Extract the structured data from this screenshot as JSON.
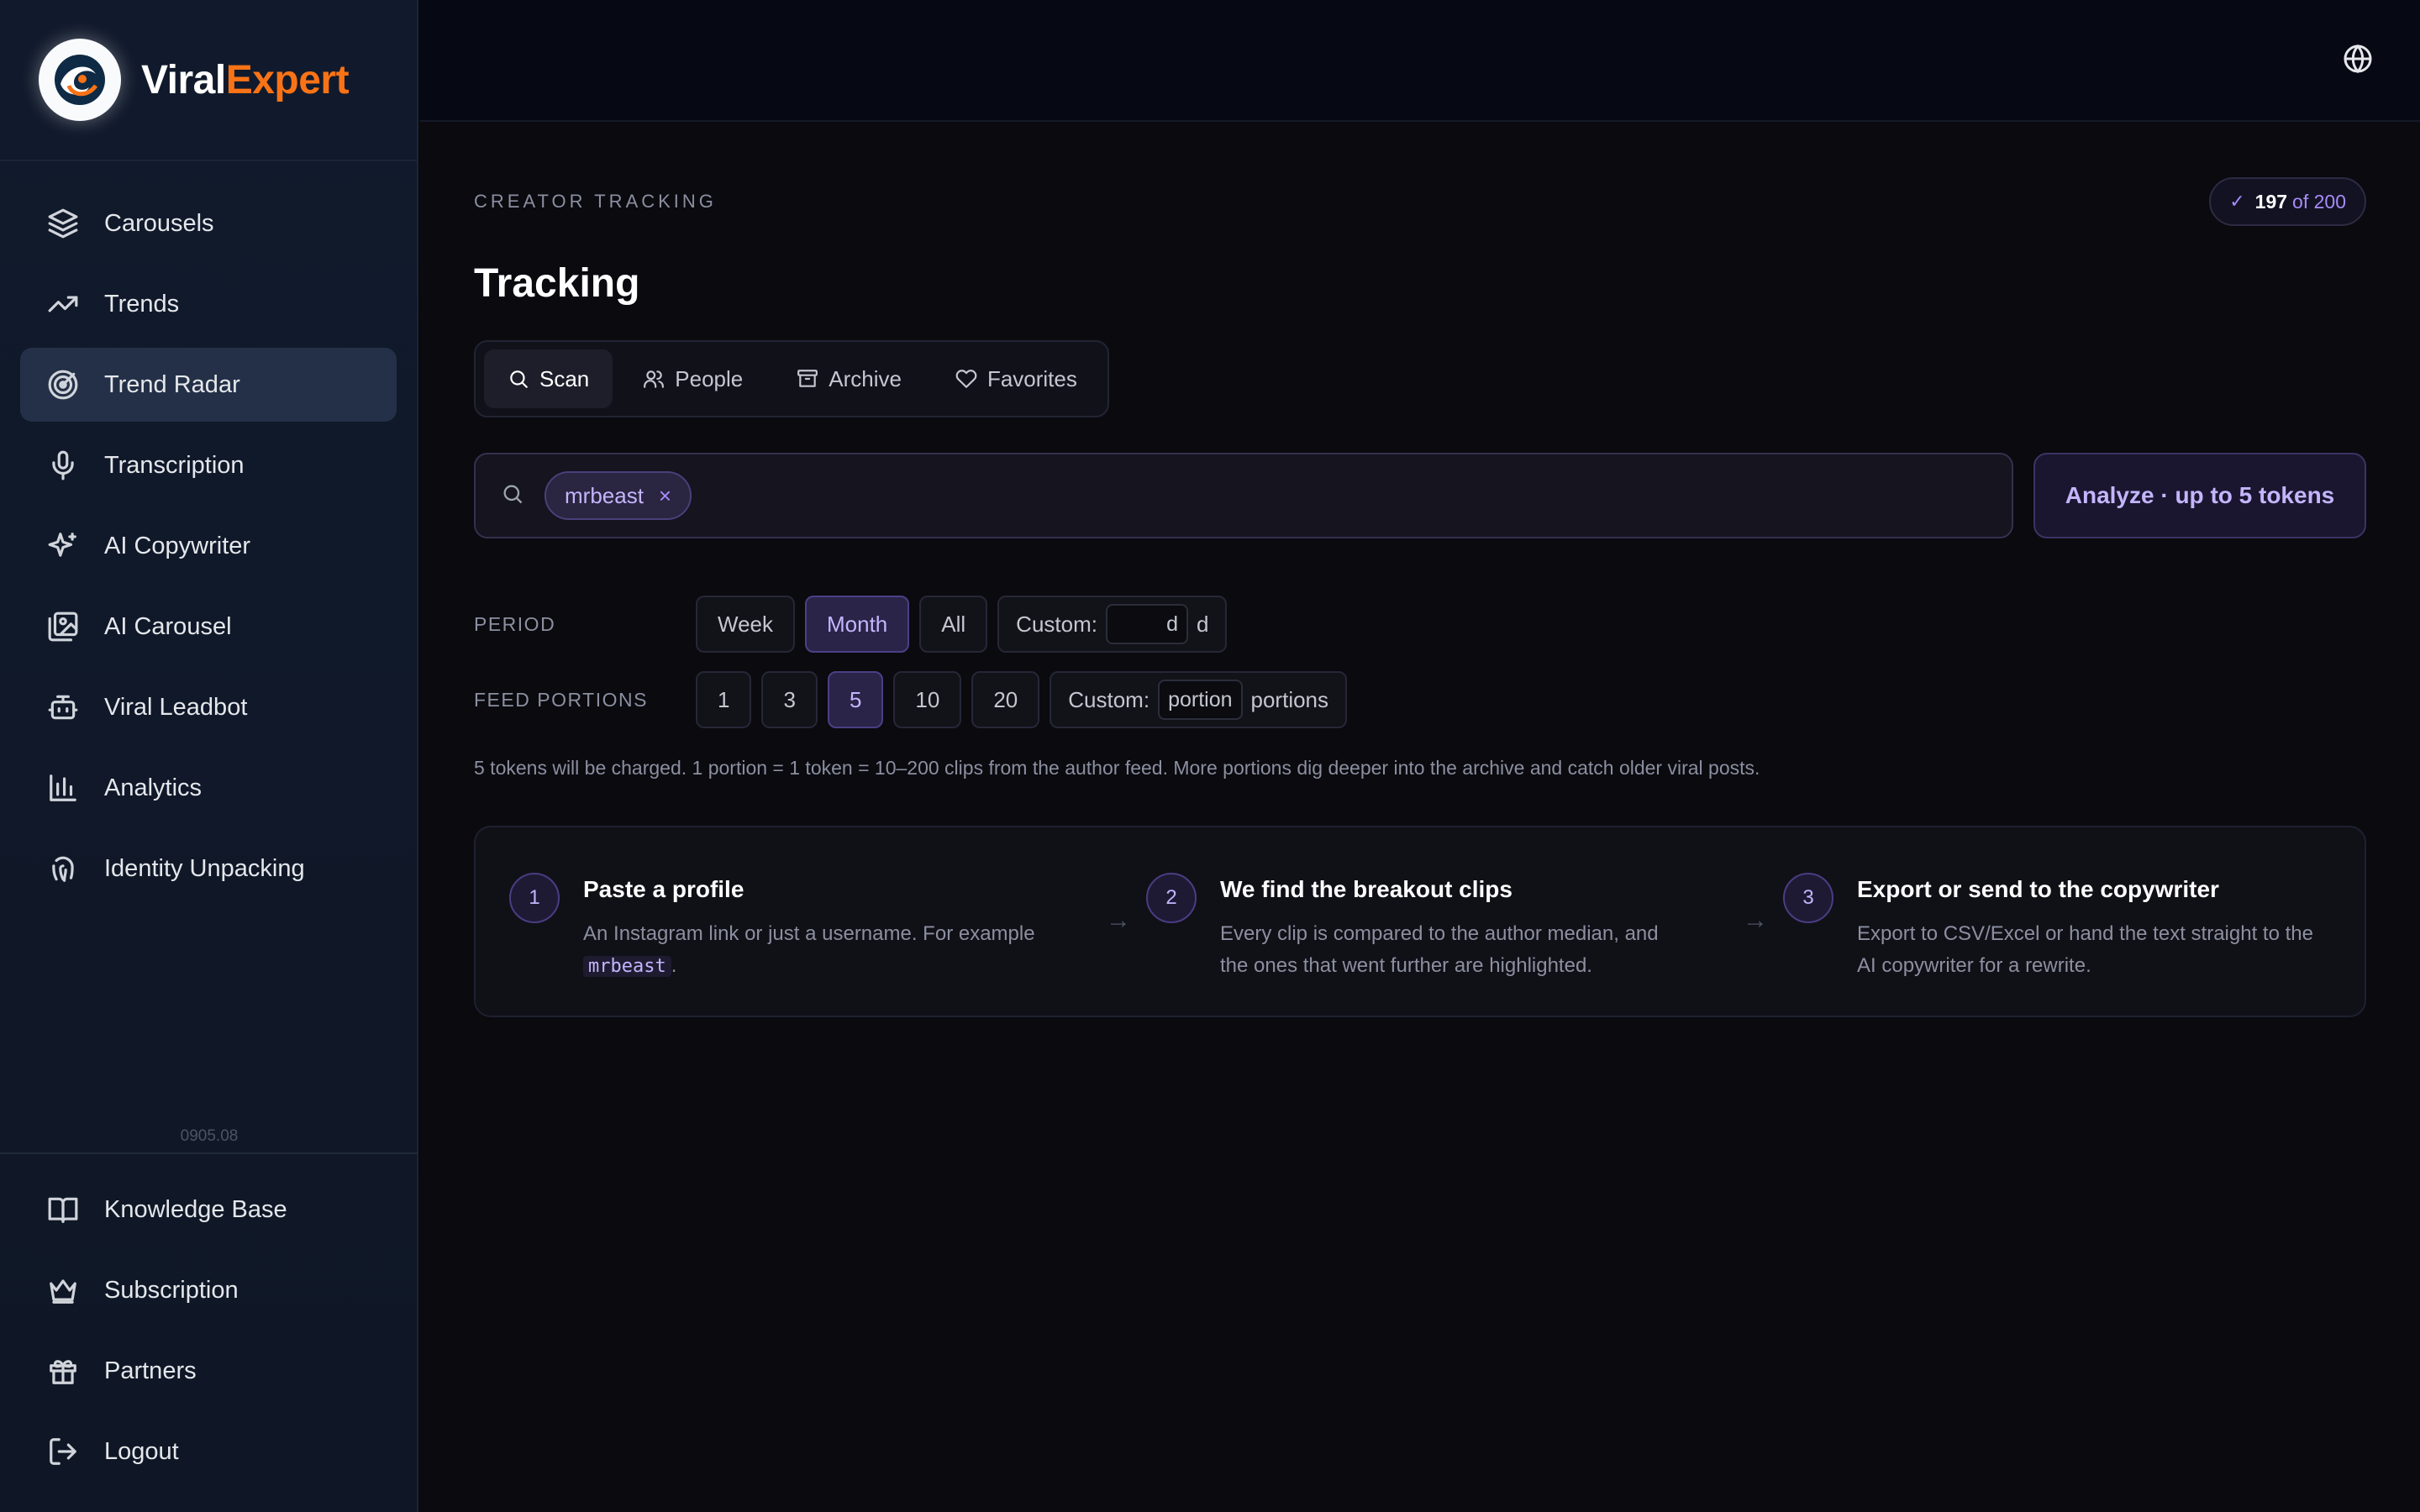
{
  "brand": {
    "name_part1": "Viral",
    "name_part2": "Expert"
  },
  "sidebar": {
    "items": [
      {
        "label": "Carousels",
        "icon": "layers-icon"
      },
      {
        "label": "Trends",
        "icon": "trending-up-icon"
      },
      {
        "label": "Trend Radar",
        "icon": "radar-icon",
        "active": true
      },
      {
        "label": "Transcription",
        "icon": "microphone-icon"
      },
      {
        "label": "AI Copywriter",
        "icon": "sparkles-icon"
      },
      {
        "label": "AI Carousel",
        "icon": "image-gallery-icon"
      },
      {
        "label": "Viral Leadbot",
        "icon": "bot-icon"
      },
      {
        "label": "Analytics",
        "icon": "bar-chart-icon"
      },
      {
        "label": "Identity Unpacking",
        "icon": "fingerprint-icon"
      }
    ],
    "version": "0905.08",
    "bottom_items": [
      {
        "label": "Knowledge Base",
        "icon": "book-icon"
      },
      {
        "label": "Subscription",
        "icon": "crown-icon"
      },
      {
        "label": "Partners",
        "icon": "gift-icon"
      },
      {
        "label": "Logout",
        "icon": "logout-icon"
      }
    ]
  },
  "topbar": {
    "language_icon": "globe-icon"
  },
  "main": {
    "eyebrow": "CREATOR TRACKING",
    "title": "Tracking",
    "quota": {
      "current": "197",
      "total": "of 200"
    },
    "tabs": [
      {
        "label": "Scan",
        "icon": "search-icon",
        "active": true
      },
      {
        "label": "People",
        "icon": "users-icon"
      },
      {
        "label": "Archive",
        "icon": "archive-icon"
      },
      {
        "label": "Favorites",
        "icon": "heart-icon"
      }
    ],
    "search": {
      "chip": "mrbeast",
      "chip_remove": "×"
    },
    "analyze_label": "Analyze · up to 5 tokens",
    "period": {
      "label": "PERIOD",
      "options": [
        "Week",
        "Month",
        "All"
      ],
      "selected": "Month",
      "custom_label": "Custom:",
      "custom_value": "d",
      "custom_unit": "d"
    },
    "portions": {
      "label": "FEED PORTIONS",
      "options": [
        "1",
        "3",
        "5",
        "10",
        "20"
      ],
      "selected": "5",
      "custom_label": "Custom:",
      "custom_placeholder": "portion",
      "custom_unit": "portions"
    },
    "note": "5 tokens will be charged. 1 portion = 1 token = 10–200 clips from the author feed. More portions dig deeper into the archive and catch older viral posts.",
    "steps": [
      {
        "num": "1",
        "title": "Paste a profile",
        "desc": "An Instagram link or just a username. For example",
        "code": "mrbeast",
        "desc_end": "."
      },
      {
        "num": "2",
        "title": "We find the breakout clips",
        "desc": "Every clip is compared to the author median, and the ones that went further are highlighted."
      },
      {
        "num": "3",
        "title": "Export or send to the copywriter",
        "desc": "Export to CSV/Excel or hand the text straight to the AI copywriter for a rewrite."
      }
    ],
    "step_arrow": "→"
  }
}
